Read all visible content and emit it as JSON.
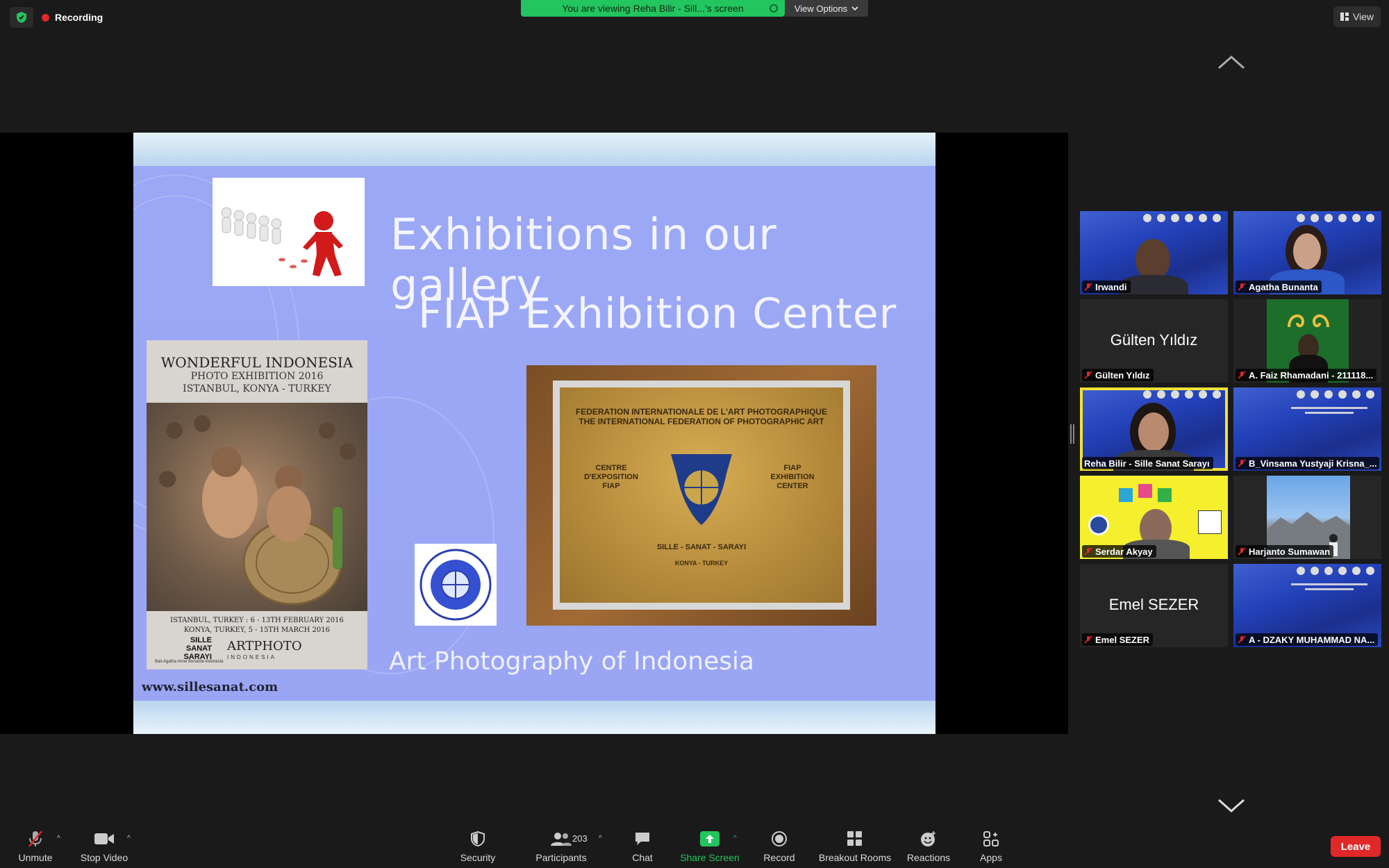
{
  "top": {
    "recording_label": "Recording",
    "banner_text": "You are viewing Reha Bilir - Sill...'s screen",
    "view_options_label": "View Options",
    "view_label": "View"
  },
  "slide": {
    "title": "Exhibitions in our gallery",
    "subtitle": "FIAP Exhibition Center",
    "footer": "Art Photography of Indonesia",
    "url": "www.sillesanat.com",
    "poster": {
      "title": "WONDERFUL INDONESIA",
      "line2": "PHOTO EXHIBITION 2016",
      "line3": "ISTANBUL, KONYA - TURKEY",
      "dates1": "ISTANBUL, TURKEY : 6 - 13TH FEBRUARY 2016",
      "dates2": "KONYA, TURKEY, 5 - 15TH MARCH 2016",
      "logo_sille": "SILLE SANAT SARAYI",
      "logo_artphoto": "ARTPHOTO",
      "logo_artphoto_sub": "INDONESIA",
      "caption": "Bali-Agatha Anne Bunanta-Indonesia"
    },
    "plaque": {
      "line1": "FEDERATION INTERNATIONALE DE L'ART PHOTOGRAPHIQUE",
      "line2": "THE INTERNATIONAL FEDERATION OF PHOTOGRAPHIC ART",
      "left": "CENTRE D'EXPOSITION FIAP",
      "right": "FIAP EXHIBITION CENTER",
      "bottom1": "SILLE - SANAT - SARAYI",
      "bottom2": "KONYA - TURKEY"
    }
  },
  "participants": [
    {
      "name": "Irwandi",
      "video": true
    },
    {
      "name": "Agatha Bunanta",
      "video": true
    },
    {
      "name": "Gülten Yıldız",
      "video": false
    },
    {
      "name": "A. Faiz Rhamadani - 211118...",
      "video": true
    },
    {
      "name": "Reha Bilir - Sille Sanat Sarayı",
      "video": true,
      "active_speaker": true
    },
    {
      "name": "B_Vinsama Yustyaji Krisna_...",
      "video": true
    },
    {
      "name": "Serdar Akyay",
      "video": true
    },
    {
      "name": "Harjanto Sumawan",
      "video": true
    },
    {
      "name": "Emel SEZER",
      "video": false
    },
    {
      "name": "A - DZAKY MUHAMMAD NA...",
      "video": true
    }
  ],
  "toolbar": {
    "unmute": "Unmute",
    "stop_video": "Stop Video",
    "security": "Security",
    "participants": "Participants",
    "participants_count": "203",
    "chat": "Chat",
    "share_screen": "Share Screen",
    "record": "Record",
    "breakout_rooms": "Breakout Rooms",
    "reactions": "Reactions",
    "apps": "Apps",
    "leave": "Leave"
  },
  "colors": {
    "banner": "#22c55e",
    "share_screen": "#22c55e",
    "leave": "#e02828",
    "active_speaker": "#f2e236",
    "slide_bg": "#9aa6f4"
  }
}
